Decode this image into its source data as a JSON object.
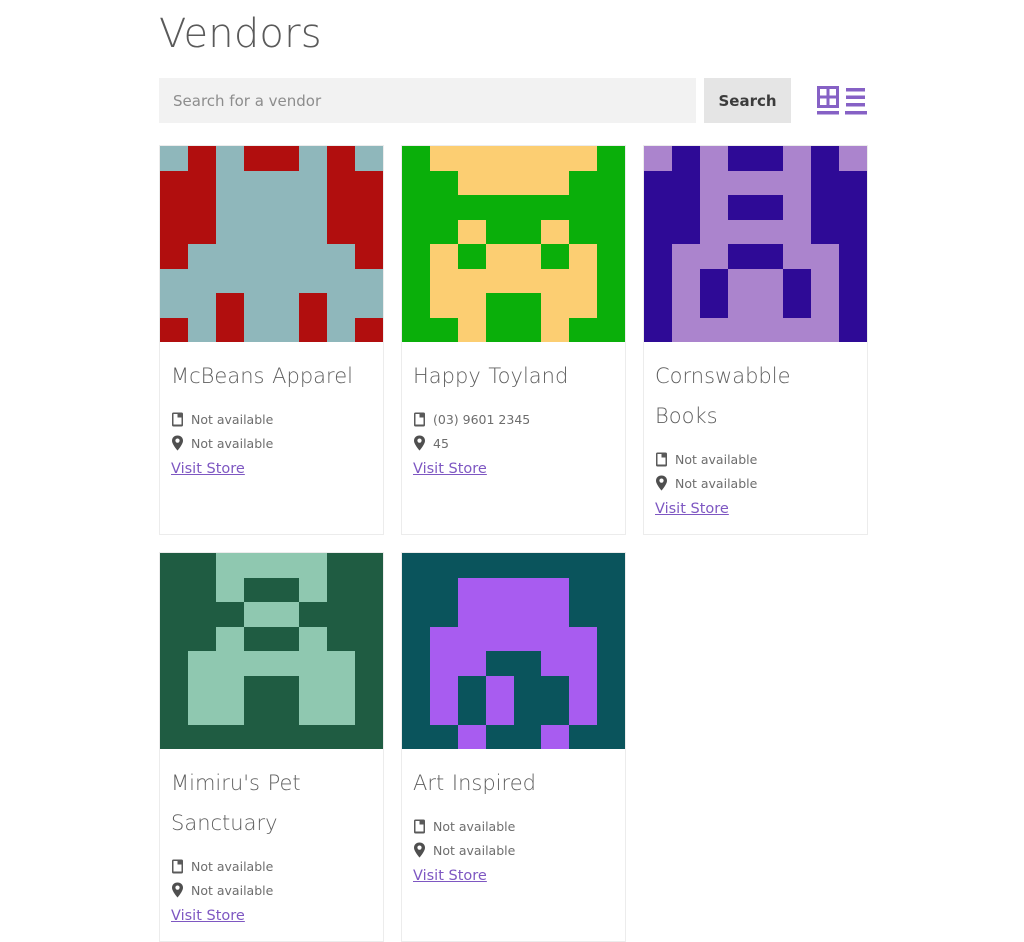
{
  "page": {
    "title": "Vendors"
  },
  "search": {
    "placeholder": "Search for a vendor",
    "value": "",
    "button_label": "Search"
  },
  "view_toggle": {
    "grid_icon": "grid-view-icon",
    "list_icon": "list-view-icon",
    "accent_color": "#8661c5"
  },
  "labels": {
    "phone_icon": "phone-icon",
    "location_icon": "map-pin-icon",
    "visit_store": "Visit Store"
  },
  "vendors": [
    {
      "name": "McBeans Apparel",
      "phone": "Not available",
      "location": "Not available",
      "link_label": "Visit Store",
      "avatar": {
        "bg": "#b10e0e",
        "fg": "#8fb7bb",
        "grid": [
          [
            1,
            0,
            1,
            0,
            0,
            1,
            0,
            1
          ],
          [
            0,
            0,
            1,
            1,
            1,
            1,
            0,
            0
          ],
          [
            0,
            0,
            1,
            1,
            1,
            1,
            0,
            0
          ],
          [
            0,
            0,
            1,
            1,
            1,
            1,
            0,
            0
          ],
          [
            0,
            1,
            1,
            1,
            1,
            1,
            1,
            0
          ],
          [
            1,
            1,
            1,
            1,
            1,
            1,
            1,
            1
          ],
          [
            1,
            1,
            0,
            1,
            1,
            0,
            1,
            1
          ],
          [
            0,
            1,
            0,
            1,
            1,
            0,
            1,
            0
          ]
        ]
      }
    },
    {
      "name": "Happy Toyland",
      "phone": "(03) 9601 2345",
      "location": "45",
      "link_label": "Visit Store",
      "avatar": {
        "bg": "#0aaf0a",
        "fg": "#fcce72",
        "grid": [
          [
            0,
            1,
            1,
            1,
            1,
            1,
            1,
            0
          ],
          [
            0,
            0,
            1,
            1,
            1,
            1,
            0,
            0
          ],
          [
            0,
            0,
            0,
            0,
            0,
            0,
            0,
            0
          ],
          [
            0,
            0,
            1,
            0,
            0,
            1,
            0,
            0
          ],
          [
            0,
            1,
            0,
            1,
            1,
            0,
            1,
            0
          ],
          [
            0,
            1,
            1,
            1,
            1,
            1,
            1,
            0
          ],
          [
            0,
            1,
            1,
            0,
            0,
            1,
            1,
            0
          ],
          [
            0,
            0,
            1,
            0,
            0,
            1,
            0,
            0
          ]
        ]
      }
    },
    {
      "name": "Cornswabble Books",
      "phone": "Not available",
      "location": "Not available",
      "link_label": "Visit Store",
      "avatar": {
        "bg": "#2e0a96",
        "fg": "#ab84cd",
        "grid": [
          [
            1,
            0,
            1,
            0,
            0,
            1,
            0,
            1
          ],
          [
            0,
            0,
            1,
            1,
            1,
            1,
            0,
            0
          ],
          [
            0,
            0,
            1,
            0,
            0,
            1,
            0,
            0
          ],
          [
            0,
            0,
            1,
            1,
            1,
            1,
            0,
            0
          ],
          [
            0,
            1,
            1,
            0,
            0,
            1,
            1,
            0
          ],
          [
            0,
            1,
            0,
            1,
            1,
            0,
            1,
            0
          ],
          [
            0,
            1,
            0,
            1,
            1,
            0,
            1,
            0
          ],
          [
            0,
            1,
            1,
            1,
            1,
            1,
            1,
            0
          ]
        ]
      }
    },
    {
      "name": "Mimiru's Pet Sanctuary",
      "phone": "Not available",
      "location": "Not available",
      "link_label": "Visit Store",
      "avatar": {
        "bg": "#1f5c42",
        "fg": "#8fc8b0",
        "grid": [
          [
            0,
            0,
            1,
            1,
            1,
            1,
            0,
            0
          ],
          [
            0,
            0,
            1,
            0,
            0,
            1,
            0,
            0
          ],
          [
            0,
            0,
            0,
            1,
            1,
            0,
            0,
            0
          ],
          [
            0,
            0,
            1,
            0,
            0,
            1,
            0,
            0
          ],
          [
            0,
            1,
            1,
            1,
            1,
            1,
            1,
            0
          ],
          [
            0,
            1,
            1,
            0,
            0,
            1,
            1,
            0
          ],
          [
            0,
            1,
            1,
            0,
            0,
            1,
            1,
            0
          ],
          [
            0,
            0,
            0,
            0,
            0,
            0,
            0,
            0
          ]
        ]
      }
    },
    {
      "name": "Art Inspired",
      "phone": "Not available",
      "location": "Not available",
      "link_label": "Visit Store",
      "avatar": {
        "bg": "#0a545c",
        "fg": "#a85cf0",
        "grid": [
          [
            0,
            0,
            0,
            0,
            0,
            0,
            0,
            0
          ],
          [
            0,
            0,
            1,
            1,
            1,
            1,
            0,
            0
          ],
          [
            0,
            0,
            1,
            1,
            1,
            1,
            0,
            0
          ],
          [
            0,
            1,
            1,
            1,
            1,
            1,
            1,
            0
          ],
          [
            0,
            1,
            1,
            0,
            0,
            1,
            1,
            0
          ],
          [
            0,
            1,
            0,
            1,
            0,
            0,
            1,
            0
          ],
          [
            0,
            1,
            0,
            1,
            0,
            0,
            1,
            0
          ],
          [
            0,
            0,
            1,
            0,
            0,
            1,
            0,
            0
          ]
        ]
      }
    }
  ]
}
